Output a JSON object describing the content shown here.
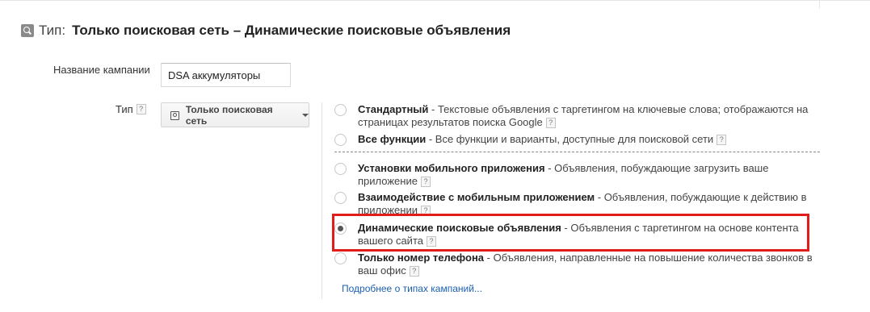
{
  "header": {
    "prefix": "Тип:",
    "title": "Только поисковая сеть – Динамические поисковые объявления",
    "icon": "search-icon"
  },
  "campaign_name": {
    "label": "Название кампании",
    "value": "DSA аккумуляторы"
  },
  "type_field": {
    "label": "Тип",
    "dropdown_label": "Только поисковая сеть"
  },
  "help_glyph": "?",
  "options": [
    {
      "title": "Стандартный",
      "desc": " - Текстовые объявления с таргетингом на ключевые слова; отображаются на страницах результатов поиска Google",
      "selected": false
    },
    {
      "title": "Все функции",
      "desc": " - Все функции и варианты, доступные для поисковой сети",
      "selected": false
    },
    {
      "title": "Установки мобильного приложения",
      "desc": " - Объявления, побуждающие загрузить ваше приложение",
      "selected": false
    },
    {
      "title": "Взаимодействие с мобильным приложением",
      "desc": " - Объявления, побуждающие к действию в приложении",
      "selected": false
    },
    {
      "title": "Динамические поисковые объявления",
      "desc": " - Объявления с таргетингом на основе контента вашего сайта",
      "selected": true
    },
    {
      "title": "Только номер телефона",
      "desc": " - Объявления, направленные на повышение количества звонков в ваш офис",
      "selected": false
    }
  ],
  "more_link": "Подробнее о типах кампаний...",
  "colors": {
    "highlight": "#e21b1b",
    "link": "#1a5fb4"
  }
}
